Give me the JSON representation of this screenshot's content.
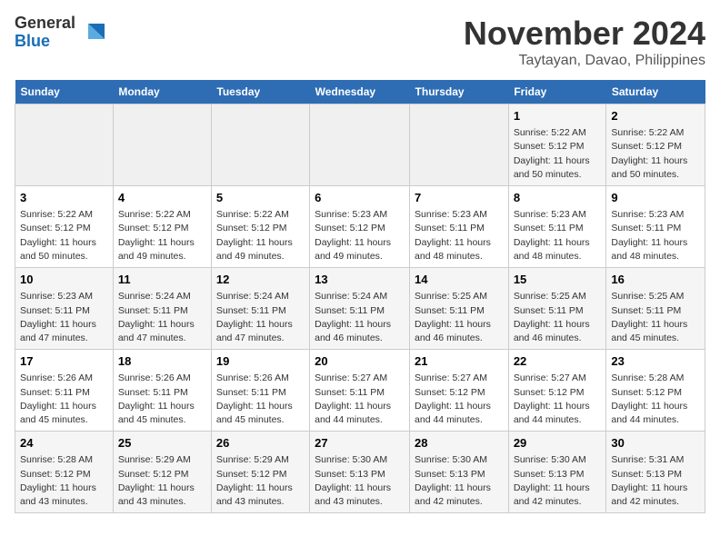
{
  "logo": {
    "general": "General",
    "blue": "Blue"
  },
  "title": "November 2024",
  "location": "Taytayan, Davao, Philippines",
  "days_header": [
    "Sunday",
    "Monday",
    "Tuesday",
    "Wednesday",
    "Thursday",
    "Friday",
    "Saturday"
  ],
  "weeks": [
    [
      {
        "day": "",
        "info": ""
      },
      {
        "day": "",
        "info": ""
      },
      {
        "day": "",
        "info": ""
      },
      {
        "day": "",
        "info": ""
      },
      {
        "day": "",
        "info": ""
      },
      {
        "day": "1",
        "info": "Sunrise: 5:22 AM\nSunset: 5:12 PM\nDaylight: 11 hours\nand 50 minutes."
      },
      {
        "day": "2",
        "info": "Sunrise: 5:22 AM\nSunset: 5:12 PM\nDaylight: 11 hours\nand 50 minutes."
      }
    ],
    [
      {
        "day": "3",
        "info": "Sunrise: 5:22 AM\nSunset: 5:12 PM\nDaylight: 11 hours\nand 50 minutes."
      },
      {
        "day": "4",
        "info": "Sunrise: 5:22 AM\nSunset: 5:12 PM\nDaylight: 11 hours\nand 49 minutes."
      },
      {
        "day": "5",
        "info": "Sunrise: 5:22 AM\nSunset: 5:12 PM\nDaylight: 11 hours\nand 49 minutes."
      },
      {
        "day": "6",
        "info": "Sunrise: 5:23 AM\nSunset: 5:12 PM\nDaylight: 11 hours\nand 49 minutes."
      },
      {
        "day": "7",
        "info": "Sunrise: 5:23 AM\nSunset: 5:11 PM\nDaylight: 11 hours\nand 48 minutes."
      },
      {
        "day": "8",
        "info": "Sunrise: 5:23 AM\nSunset: 5:11 PM\nDaylight: 11 hours\nand 48 minutes."
      },
      {
        "day": "9",
        "info": "Sunrise: 5:23 AM\nSunset: 5:11 PM\nDaylight: 11 hours\nand 48 minutes."
      }
    ],
    [
      {
        "day": "10",
        "info": "Sunrise: 5:23 AM\nSunset: 5:11 PM\nDaylight: 11 hours\nand 47 minutes."
      },
      {
        "day": "11",
        "info": "Sunrise: 5:24 AM\nSunset: 5:11 PM\nDaylight: 11 hours\nand 47 minutes."
      },
      {
        "day": "12",
        "info": "Sunrise: 5:24 AM\nSunset: 5:11 PM\nDaylight: 11 hours\nand 47 minutes."
      },
      {
        "day": "13",
        "info": "Sunrise: 5:24 AM\nSunset: 5:11 PM\nDaylight: 11 hours\nand 46 minutes."
      },
      {
        "day": "14",
        "info": "Sunrise: 5:25 AM\nSunset: 5:11 PM\nDaylight: 11 hours\nand 46 minutes."
      },
      {
        "day": "15",
        "info": "Sunrise: 5:25 AM\nSunset: 5:11 PM\nDaylight: 11 hours\nand 46 minutes."
      },
      {
        "day": "16",
        "info": "Sunrise: 5:25 AM\nSunset: 5:11 PM\nDaylight: 11 hours\nand 45 minutes."
      }
    ],
    [
      {
        "day": "17",
        "info": "Sunrise: 5:26 AM\nSunset: 5:11 PM\nDaylight: 11 hours\nand 45 minutes."
      },
      {
        "day": "18",
        "info": "Sunrise: 5:26 AM\nSunset: 5:11 PM\nDaylight: 11 hours\nand 45 minutes."
      },
      {
        "day": "19",
        "info": "Sunrise: 5:26 AM\nSunset: 5:11 PM\nDaylight: 11 hours\nand 45 minutes."
      },
      {
        "day": "20",
        "info": "Sunrise: 5:27 AM\nSunset: 5:11 PM\nDaylight: 11 hours\nand 44 minutes."
      },
      {
        "day": "21",
        "info": "Sunrise: 5:27 AM\nSunset: 5:12 PM\nDaylight: 11 hours\nand 44 minutes."
      },
      {
        "day": "22",
        "info": "Sunrise: 5:27 AM\nSunset: 5:12 PM\nDaylight: 11 hours\nand 44 minutes."
      },
      {
        "day": "23",
        "info": "Sunrise: 5:28 AM\nSunset: 5:12 PM\nDaylight: 11 hours\nand 44 minutes."
      }
    ],
    [
      {
        "day": "24",
        "info": "Sunrise: 5:28 AM\nSunset: 5:12 PM\nDaylight: 11 hours\nand 43 minutes."
      },
      {
        "day": "25",
        "info": "Sunrise: 5:29 AM\nSunset: 5:12 PM\nDaylight: 11 hours\nand 43 minutes."
      },
      {
        "day": "26",
        "info": "Sunrise: 5:29 AM\nSunset: 5:12 PM\nDaylight: 11 hours\nand 43 minutes."
      },
      {
        "day": "27",
        "info": "Sunrise: 5:30 AM\nSunset: 5:13 PM\nDaylight: 11 hours\nand 43 minutes."
      },
      {
        "day": "28",
        "info": "Sunrise: 5:30 AM\nSunset: 5:13 PM\nDaylight: 11 hours\nand 42 minutes."
      },
      {
        "day": "29",
        "info": "Sunrise: 5:30 AM\nSunset: 5:13 PM\nDaylight: 11 hours\nand 42 minutes."
      },
      {
        "day": "30",
        "info": "Sunrise: 5:31 AM\nSunset: 5:13 PM\nDaylight: 11 hours\nand 42 minutes."
      }
    ]
  ]
}
